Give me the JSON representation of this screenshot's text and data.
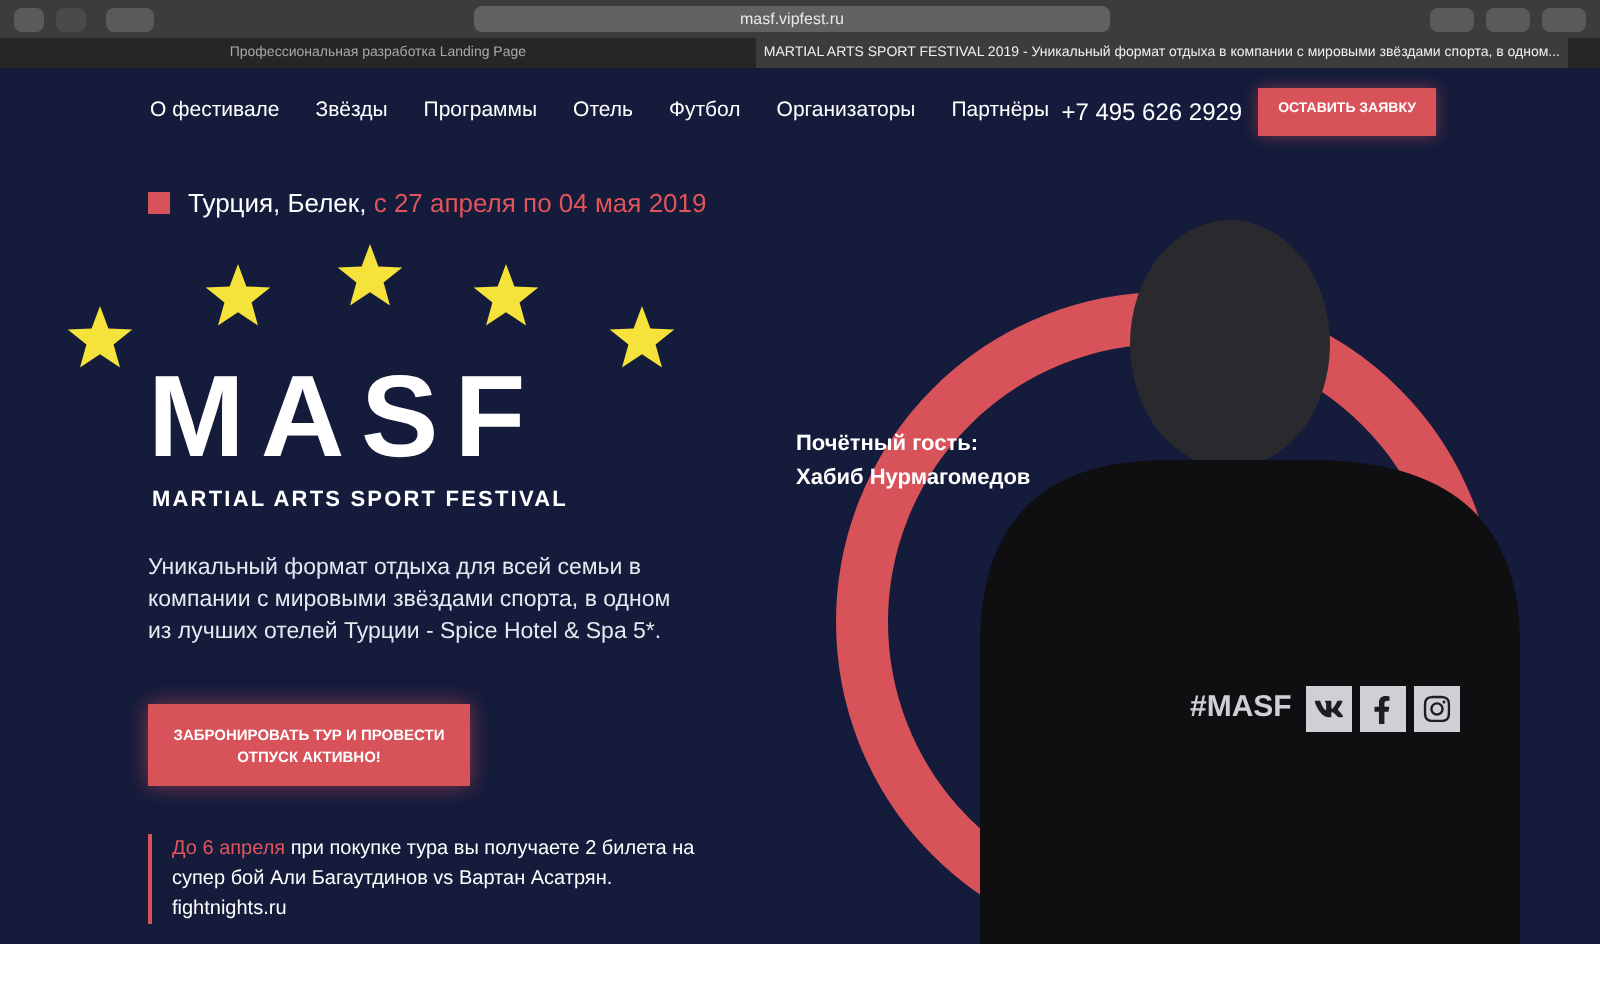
{
  "browser": {
    "url": "masf.vipfest.ru",
    "tabs": [
      {
        "title": "Профессиональная разработка Landing Page",
        "selected": false
      },
      {
        "title": "MARTIAL ARTS SPORT FESTIVAL 2019 - Уникальный формат отдыха в компании с мировыми звёздами спорта, в одном...",
        "selected": true
      }
    ]
  },
  "nav": {
    "items": [
      "О фестивале",
      "Звёзды",
      "Программы",
      "Отель",
      "Футбол",
      "Организаторы",
      "Партнёры"
    ],
    "phone": "+7 495 626 2929",
    "cta": "ОСТАВИТЬ ЗАЯВКУ"
  },
  "location": {
    "place": "Турция, Белек, ",
    "dates": "с 27 апреля по 04 мая 2019"
  },
  "logo": {
    "title": "MASF",
    "subtitle": "MARTIAL ARTS SPORT FESTIVAL"
  },
  "description": "Уникальный формат отдыха для всей семьи в компании с мировыми звёздами спорта, в одном из лучших отелей Турции - Spice Hotel & Spa 5*.",
  "book_button": "ЗАБРОНИРОВАТЬ ТУР И ПРОВЕСТИ ОТПУСК АКТИВНО!",
  "promo": {
    "highlight": "До 6 апреля",
    "text": " при покупке тура вы получаете 2 билета на супер бой Али Багаутдинов vs Вартан Асатрян.",
    "link": "fightnights.ru"
  },
  "guest": {
    "label": "Почётный гость:",
    "name": "Хабиб Нурмагомедов"
  },
  "hashtag": "#MASF"
}
